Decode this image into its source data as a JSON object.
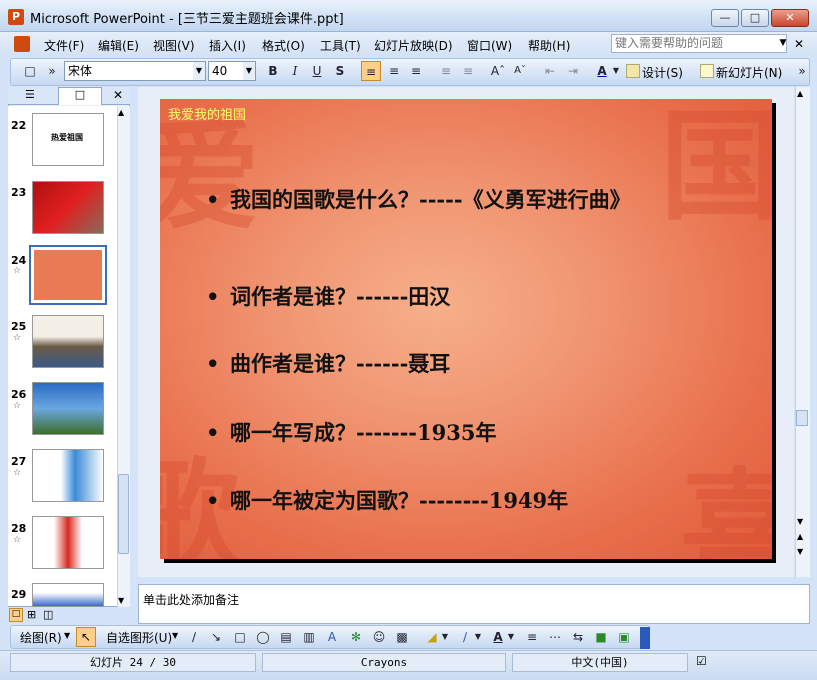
{
  "window": {
    "title": "Microsoft PowerPoint - [三节三爱主题班会课件.ppt]",
    "app_icon": "P"
  },
  "menu": [
    "文件(F)",
    "编辑(E)",
    "视图(V)",
    "插入(I)",
    "格式(O)",
    "工具(T)",
    "幻灯片放映(D)",
    "窗口(W)",
    "帮助(H)"
  ],
  "help_placeholder": "键入需要帮助的问题",
  "format_toolbar": {
    "font": "宋体",
    "size": "40",
    "design_label": "设计(S)",
    "new_slide_label": "新幻灯片(N)"
  },
  "thumbnails": [
    {
      "num": "22",
      "text": "热爱祖国"
    },
    {
      "num": "23",
      "text": ""
    },
    {
      "num": "24",
      "text": ""
    },
    {
      "num": "25",
      "text": ""
    },
    {
      "num": "26",
      "text": ""
    },
    {
      "num": "27",
      "text": ""
    },
    {
      "num": "28",
      "text": ""
    },
    {
      "num": "29",
      "text": ""
    }
  ],
  "slide": {
    "title": "我爱我的祖国",
    "bullets": [
      "我国的国歌是什么？-----《义勇军进行曲》",
      "词作者是谁？------田汉",
      "曲作者是谁？------聂耳",
      "哪一年写成？-------1935年",
      "哪一年被定为国歌？--------1949年"
    ]
  },
  "notes_placeholder": "单击此处添加备注",
  "drawing_toolbar": {
    "draw_label": "绘图(R)",
    "autoshape_label": "自选图形(U)"
  },
  "status": {
    "slide": "幻灯片 24 / 30",
    "design": "Crayons",
    "language": "中文(中国)"
  }
}
